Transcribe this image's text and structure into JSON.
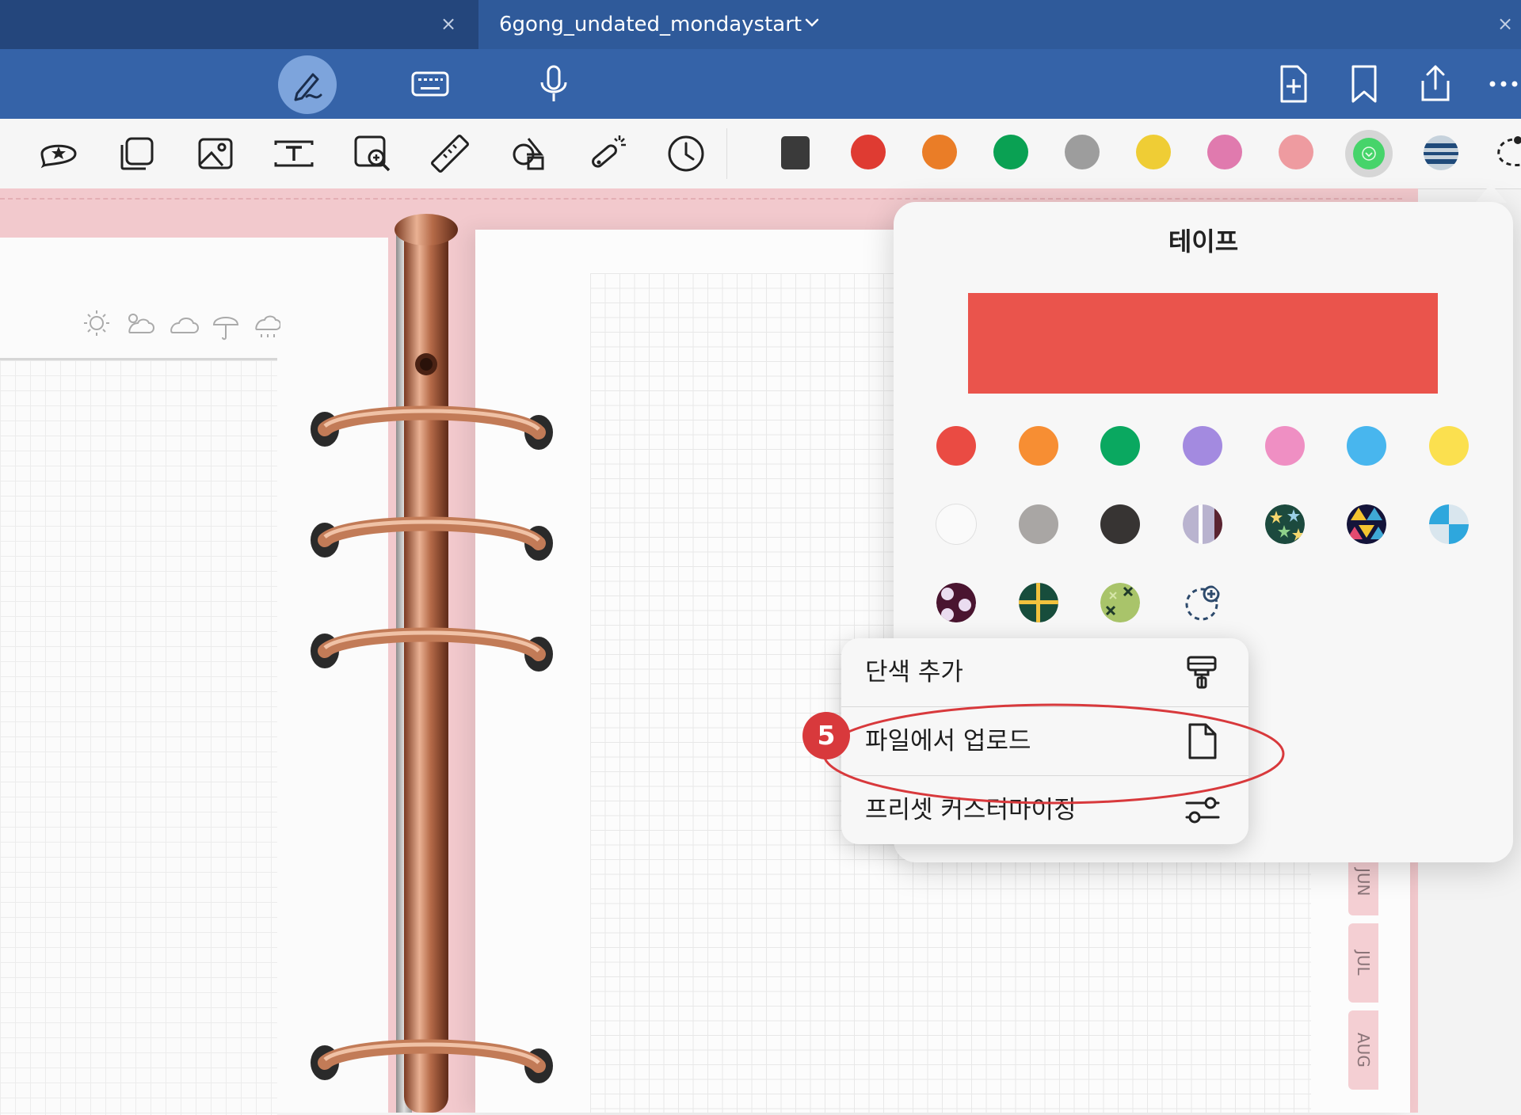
{
  "tabs": {
    "inactive_close": "×",
    "active_title": "6gong_undated_mondaystart",
    "window_close": "×"
  },
  "mode_bar": {
    "modes": [
      "pen-mode",
      "keyboard-mode",
      "voice-mode"
    ],
    "actions": [
      "add-page",
      "bookmark",
      "share",
      "more"
    ]
  },
  "toolbar": {
    "tools": [
      "sticker",
      "sticky-note",
      "image",
      "text-box",
      "image-search",
      "ruler",
      "shapes",
      "laser-pointer",
      "timer"
    ],
    "swatches": [
      "#3a3a3a",
      "#df3b32",
      "#ea7d27",
      "#0aa153",
      "#9d9d9d",
      "#efcd35",
      "#e07aae",
      "#ee9ba0",
      "#46d46a",
      "#1f4a7a"
    ]
  },
  "popover": {
    "title": "테이프",
    "preview_color": "#ea544c",
    "solid_colors": [
      "#ea4b43",
      "#f78e33",
      "#0aa860",
      "#a38ae0",
      "#ef8fc3",
      "#48b6ee",
      "#fbe04f"
    ],
    "pattern_row": [
      "white",
      "gray",
      "dark",
      "stripe",
      "stars",
      "triangles",
      "checker-blue"
    ],
    "custom_row": [
      "dots-burgundy",
      "plaid-green",
      "cross-olive",
      "add-custom"
    ]
  },
  "menu": {
    "items": [
      {
        "label": "단색 추가",
        "icon": "paint-roller-icon"
      },
      {
        "label": "파일에서 업로드",
        "icon": "file-icon"
      },
      {
        "label": "프리셋 커스터마이징",
        "icon": "sliders-icon"
      }
    ]
  },
  "annotation": {
    "step": "5",
    "color": "#d8393c"
  },
  "planner": {
    "month_tabs": [
      "JUN",
      "JUL",
      "AUG"
    ]
  }
}
